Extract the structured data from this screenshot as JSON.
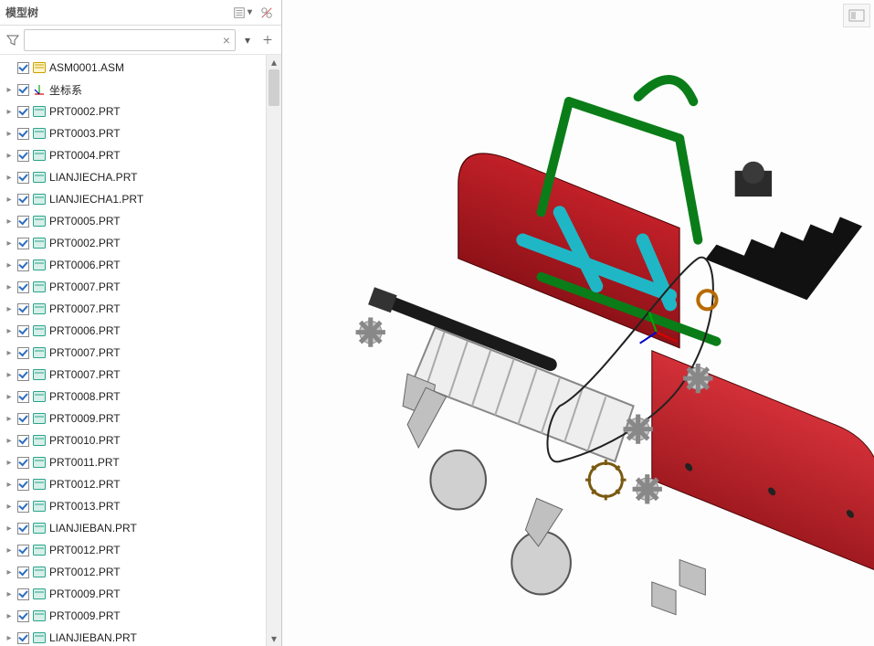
{
  "panel": {
    "title": "模型树",
    "search_placeholder": ""
  },
  "tree": {
    "root": {
      "label": "ASM0001.ASM",
      "icon": "asm"
    },
    "children": [
      {
        "label": "坐标系",
        "icon": "csys"
      },
      {
        "label": "PRT0002.PRT",
        "icon": "prt"
      },
      {
        "label": "PRT0003.PRT",
        "icon": "prt"
      },
      {
        "label": "PRT0004.PRT",
        "icon": "prt"
      },
      {
        "label": "LIANJIECHA.PRT",
        "icon": "prt"
      },
      {
        "label": "LIANJIECHA1.PRT",
        "icon": "prt"
      },
      {
        "label": "PRT0005.PRT",
        "icon": "prt"
      },
      {
        "label": "PRT0002.PRT",
        "icon": "prt"
      },
      {
        "label": "PRT0006.PRT",
        "icon": "prt"
      },
      {
        "label": "PRT0007.PRT",
        "icon": "prt"
      },
      {
        "label": "PRT0007.PRT",
        "icon": "prt"
      },
      {
        "label": "PRT0006.PRT",
        "icon": "prt"
      },
      {
        "label": "PRT0007.PRT",
        "icon": "prt"
      },
      {
        "label": "PRT0007.PRT",
        "icon": "prt"
      },
      {
        "label": "PRT0008.PRT",
        "icon": "prt"
      },
      {
        "label": "PRT0009.PRT",
        "icon": "prt"
      },
      {
        "label": "PRT0010.PRT",
        "icon": "prt"
      },
      {
        "label": "PRT0011.PRT",
        "icon": "prt"
      },
      {
        "label": "PRT0012.PRT",
        "icon": "prt"
      },
      {
        "label": "PRT0013.PRT",
        "icon": "prt"
      },
      {
        "label": "LIANJIEBAN.PRT",
        "icon": "prt"
      },
      {
        "label": "PRT0012.PRT",
        "icon": "prt"
      },
      {
        "label": "PRT0012.PRT",
        "icon": "prt"
      },
      {
        "label": "PRT0009.PRT",
        "icon": "prt"
      },
      {
        "label": "PRT0009.PRT",
        "icon": "prt"
      },
      {
        "label": "LIANJIEBAN.PRT",
        "icon": "prt"
      }
    ]
  }
}
